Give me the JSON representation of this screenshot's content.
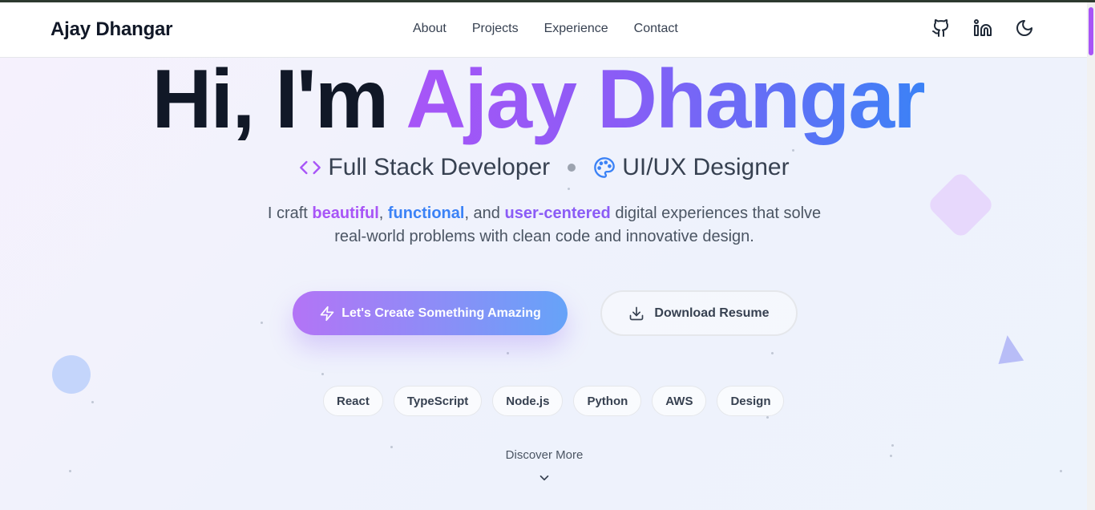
{
  "header": {
    "brand": "Ajay Dhangar",
    "nav": [
      "About",
      "Projects",
      "Experience",
      "Contact"
    ],
    "icons": [
      "github-icon",
      "linkedin-icon",
      "moon-icon"
    ]
  },
  "hero": {
    "greeting": "Hi, I'm",
    "name": "Ajay Dhangar",
    "roles": [
      {
        "icon": "code-icon",
        "label": "Full Stack Developer"
      },
      {
        "icon": "palette-icon",
        "label": "UI/UX Designer"
      }
    ],
    "tagline": {
      "t1": "I craft ",
      "w1": "beautiful",
      "t2": ", ",
      "w2": "functional",
      "t3": ", and ",
      "w3": "user-centered",
      "t4": " digital experiences that solve",
      "line2": "real-world problems with clean code and innovative design."
    },
    "cta_primary": "Let's Create Something Amazing",
    "cta_secondary": "Download Resume",
    "skills": [
      "React",
      "TypeScript",
      "Node.js",
      "Python",
      "AWS",
      "Design"
    ],
    "discover": "Discover More"
  },
  "colors": {
    "accent_purple": "#a855f7",
    "accent_blue": "#3b82f6",
    "text_dark": "#111827"
  }
}
